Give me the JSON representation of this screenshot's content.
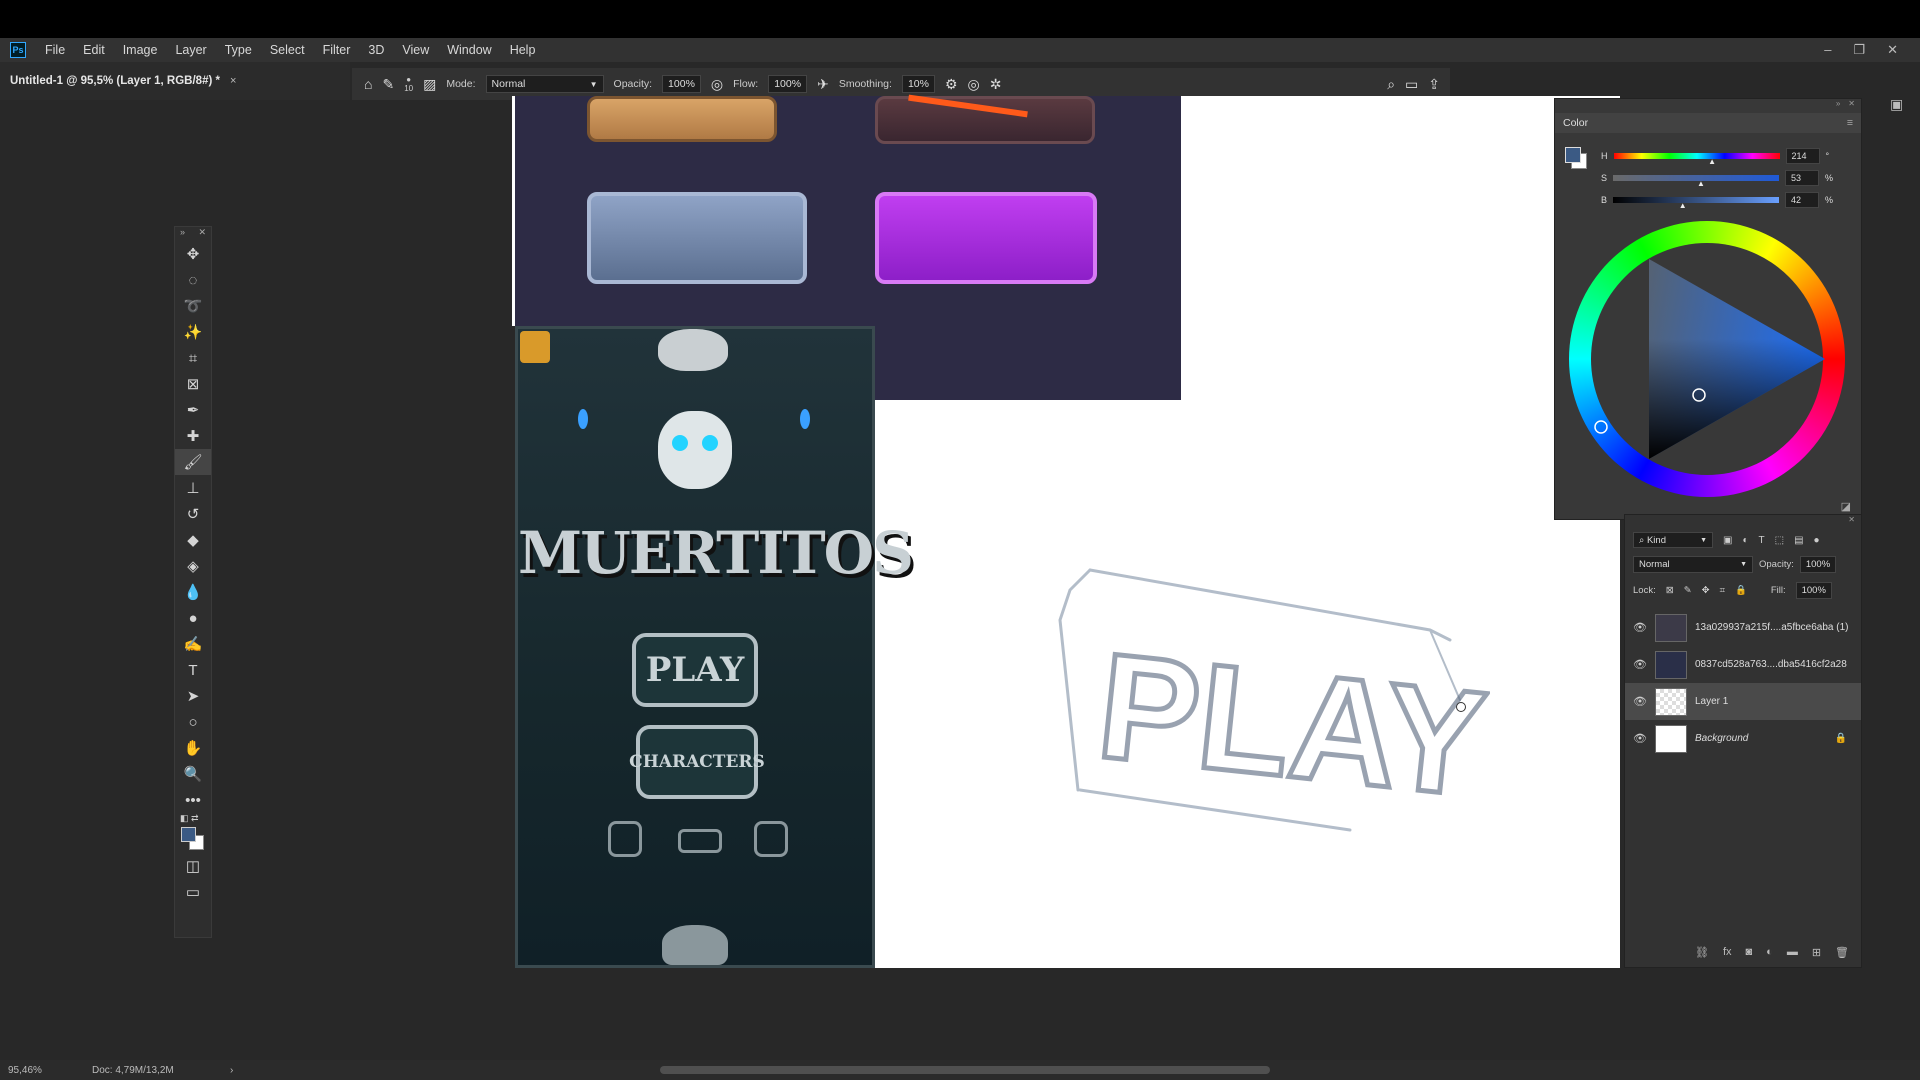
{
  "menubar": {
    "logo": "Ps",
    "items": [
      "File",
      "Edit",
      "Image",
      "Layer",
      "Type",
      "Select",
      "Filter",
      "3D",
      "View",
      "Window",
      "Help"
    ],
    "window_controls": [
      "–",
      "❐",
      "✕"
    ]
  },
  "document_tab": {
    "title": "Untitled-1 @ 95,5% (Layer 1, RGB/8#) *",
    "close": "×"
  },
  "options_bar": {
    "brush_size": "10",
    "mode_label": "Mode:",
    "mode_value": "Normal",
    "opacity_label": "Opacity:",
    "opacity_value": "100%",
    "flow_label": "Flow:",
    "flow_value": "100%",
    "smoothing_label": "Smoothing:",
    "smoothing_value": "10%"
  },
  "toolbar": {
    "tools": [
      "move-tool",
      "marquee-tool",
      "lasso-tool",
      "magic-wand-tool",
      "crop-tool",
      "frame-tool",
      "eyedropper-tool",
      "healing-tool",
      "brush-tool",
      "stamp-tool",
      "history-brush-tool",
      "eraser-tool",
      "paint-bucket-tool",
      "blur-tool",
      "dodge-tool",
      "pen-tool",
      "type-tool",
      "path-select-tool",
      "ellipse-tool",
      "hand-tool",
      "zoom-tool",
      "more-tools"
    ],
    "foreground_color": "#3b5a84",
    "background_color": "#ffffff"
  },
  "game_art": {
    "title": "MUERTITOS",
    "play": "PLAY",
    "characters": "CHARACTERS"
  },
  "sketch": {
    "text": "PLAY"
  },
  "color_panel": {
    "title": "Color",
    "h_label": "H",
    "h_value": "214",
    "h_unit": "°",
    "s_label": "S",
    "s_value": "53",
    "s_unit": "%",
    "b_label": "B",
    "b_value": "42",
    "b_unit": "%",
    "h_fraction": 0.594,
    "s_fraction": 0.53,
    "b_fraction": 0.42,
    "fill_color": "#3b5a84"
  },
  "layers_panel": {
    "filter_label": "Kind",
    "blend_mode": "Normal",
    "opacity_label": "Opacity:",
    "opacity_value": "100%",
    "lock_label": "Lock:",
    "fill_label": "Fill:",
    "fill_value": "100%",
    "layers": [
      {
        "name": "13a029937a215f....a5fbce6aba (1)"
      },
      {
        "name": "0837cd528a763....dba5416cf2a28"
      },
      {
        "name": "Layer 1"
      },
      {
        "name": "Background"
      }
    ]
  },
  "status_bar": {
    "zoom": "95,46%",
    "doc": "Doc: 4,79M/13,2M"
  }
}
